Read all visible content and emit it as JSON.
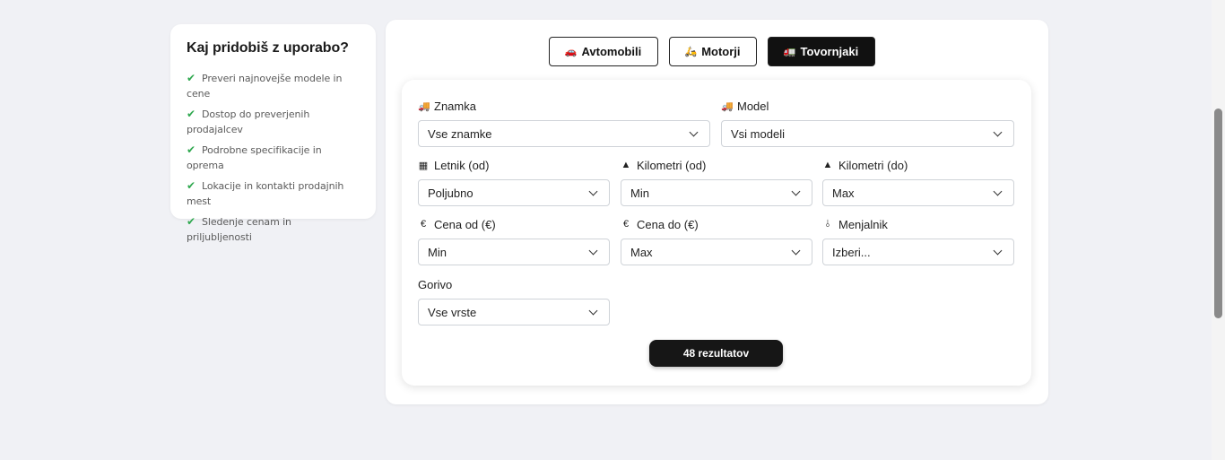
{
  "benefits": {
    "title": "Kaj pridobiš z uporabo?",
    "items": [
      "Preveri najnovejše modele in cene",
      "Dostop do preverjenih prodajalcev",
      "Podrobne specifikacije in oprema",
      "Lokacije in kontakti prodajnih mest",
      "Sledenje cenam in priljubljenosti"
    ]
  },
  "tabs": {
    "cars": "Avtomobili",
    "moto": "Motorji",
    "trucks": "Tovornjaki",
    "active": "Tovornjaki"
  },
  "form": {
    "brand": {
      "label": "Znamka",
      "value": "Vse znamke"
    },
    "model": {
      "label": "Model",
      "value": "Vsi modeli"
    },
    "year_from": {
      "label": "Letnik (od)",
      "value": "Poljubno"
    },
    "km_from": {
      "label": "Kilometri (od)",
      "value": "Min"
    },
    "km_to": {
      "label": "Kilometri (do)",
      "value": "Max"
    },
    "price_from": {
      "label": "Cena od (€)",
      "value": "Min"
    },
    "price_to": {
      "label": "Cena do (€)",
      "value": "Max"
    },
    "gearbox": {
      "label": "Menjalnik",
      "value": "Izberi..."
    },
    "fuel": {
      "label": "Gorivo",
      "value": "Vse vrste"
    }
  },
  "results_button": "48 rezultatov",
  "colors": {
    "accent_dark": "#111111",
    "check_green": "#2fa84f",
    "background": "#f0f1f5"
  },
  "icons": {
    "brand": "truck-icon",
    "model": "truck-icon",
    "year_from": "calendar-icon",
    "km": "weight-icon",
    "price": "euro-icon",
    "gearbox": "gear-shift-icon"
  }
}
